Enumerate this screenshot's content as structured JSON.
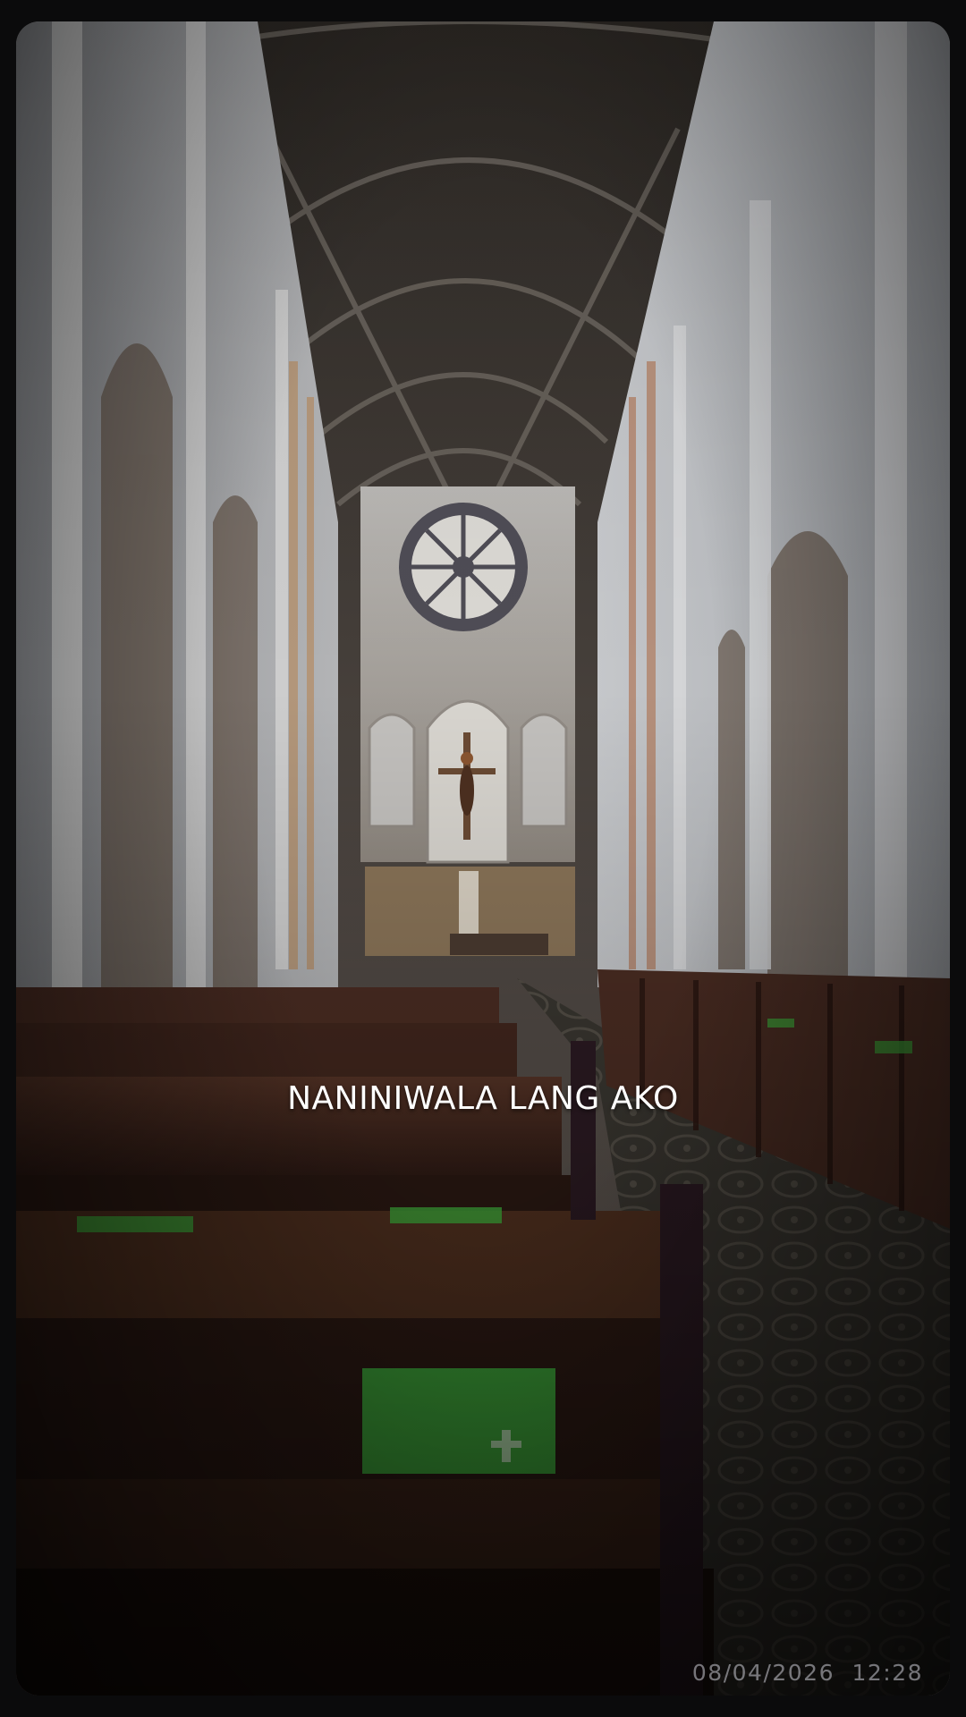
{
  "video": {
    "caption": "NANINIWALA LANG AKO",
    "date": "08/04/2026",
    "time": "12:28"
  },
  "scene": {
    "description_icon": "church-interior-photo",
    "hymnal_color": "#3fa63a",
    "wall_color": "#c9ccd0",
    "pew_color": "#4a2c22"
  }
}
